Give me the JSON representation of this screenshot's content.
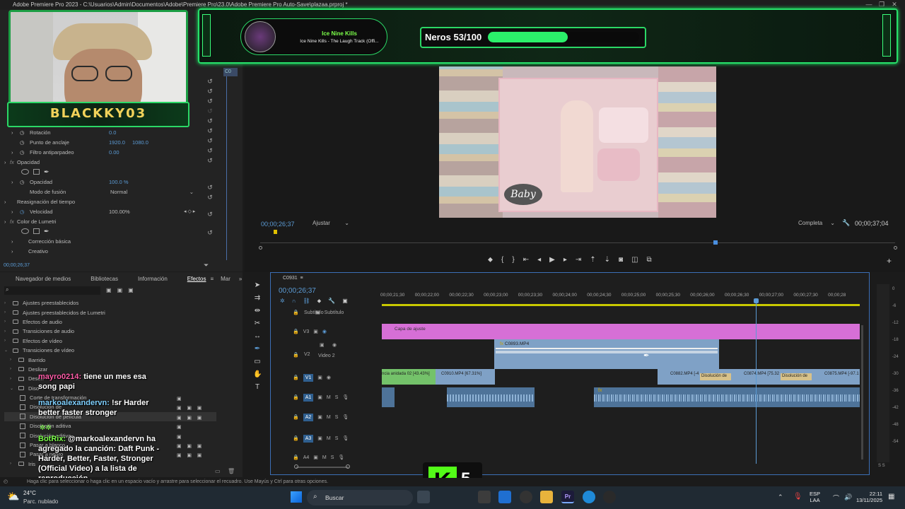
{
  "window": {
    "title": "Adobe Premiere Pro 2023 - C:\\Usuarios\\Admin\\Documentos\\Adobe\\Premiere Pro\\23.0\\Adobe Premiere Pro Auto-Save\\plazaa.prproj *",
    "controls": [
      "—",
      "❐",
      "✕"
    ]
  },
  "overlay": {
    "streamer_name": "BLACKKY03",
    "song_artist": "Ice Nine Kills",
    "song_title": "Ice Nine Kills - The Laugh Track (Offi...",
    "goal_label": "Neros 53/100",
    "goal_progress": 0.53,
    "kick_label": "5"
  },
  "effects_controls": {
    "tab_fragment": "C0",
    "rows": [
      {
        "label": "Rotación",
        "value": "0.0"
      },
      {
        "label": "Punto de anclaje",
        "value": "1920.0",
        "value2": "1080.0"
      },
      {
        "label": "Filtro antiparpadeo",
        "value": "0.00"
      },
      {
        "label": "Opacidad",
        "section": true
      },
      {
        "label": "Opacidad",
        "value": "100.0 %"
      },
      {
        "label": "Modo de fusión",
        "value": "Normal"
      },
      {
        "label": "Reasignación del tiempo",
        "section": true
      },
      {
        "label": "Velocidad",
        "value": "100.00%"
      },
      {
        "label": "Color de Lumetri",
        "section": true
      },
      {
        "label": "Corrección básica"
      },
      {
        "label": "Creativo"
      }
    ],
    "timecode": "00;00;26;37"
  },
  "program_monitor": {
    "timecode": "00;00;26;37",
    "fit": "Ajustar",
    "quality": "Completa",
    "duration": "00;00;37;04"
  },
  "effects_panel": {
    "tabs": [
      "Navegador de medios",
      "Bibliotecas",
      "Información",
      "Efectos",
      "Mar"
    ],
    "active_tab": "Efectos",
    "tree": [
      "Ajustes preestablecidos",
      "Ajustes preestablecidos de Lumetri",
      "Efectos de audio",
      "Transiciones de audio",
      "Efectos de vídeo",
      "Transiciones de vídeo",
      "Barrido",
      "Deslizar",
      "Desen",
      "Diso",
      "Corte de transformación",
      "Disolución de",
      "Disolución de película",
      "Disolución aditiva",
      "Disolución aditiva",
      "Pasar a blanco",
      "Pasar a negro",
      "Iris"
    ]
  },
  "chat": [
    {
      "user": "mayro0214:",
      "user_color": "#ff5ca8",
      "text": "tiene un mes esa song papi"
    },
    {
      "user": "markoalexandervn:",
      "user_color": "#7fd0ff",
      "text": "!sr Harder better faster stronger"
    },
    {
      "user": "BotRix:",
      "user_color": "#7cff4a",
      "text": "@markoalexandervn ha agregado la canción: Daft Punk - Harder, Better, Faster, Stronger (Official Video) a la lista de reproducción."
    }
  ],
  "timeline": {
    "sequence": "C0931",
    "timecode": "00;00;26;37",
    "ruler": [
      "00;00;21;30",
      "00;00;22;00",
      "00;00;22;30",
      "00;00;23;00",
      "00;00;23;30",
      "00;00;24;00",
      "00;00;24;30",
      "00;00;25;00",
      "00;00;25;30",
      "00;00;26;00",
      "00;00;26;30",
      "00;00;27;00",
      "00;00;27;30",
      "00;00;28"
    ],
    "tracks": {
      "c1": "Subtítulo",
      "v3": "V3",
      "v2": "V2",
      "v2_name": "Video 2",
      "v1": "V1",
      "a1": "A1",
      "a2": "A2",
      "a3": "A3",
      "a4": "A4"
    },
    "clips": {
      "adjustment": "Capa de ajuste",
      "c0893": "C0893.MP4",
      "nested": "ncia anidada 02 [43.43%]",
      "c0910": "C0910.MP4 [67.31%]",
      "c0882": "C0882.MP4 [-4",
      "c0874": "C0874.MP4 [75.32",
      "c0875": "C0875.MP4 [-97.1",
      "dissolve1": "Disolución de",
      "dissolve2": "Disolución de"
    },
    "meter_ticks": [
      "0",
      "-6",
      "-12",
      "-18",
      "-24",
      "-30",
      "-36",
      "-42",
      "-48",
      "-54"
    ],
    "meter_bottom": "S S"
  },
  "status_bar": {
    "text": "Haga clic para seleccionar o haga clic en un espacio vacío y arrastre para seleccionar el recuadro. Use Mayús y Ctrl para otras opciones."
  },
  "taskbar": {
    "weather_temp": "24°C",
    "weather_desc": "Parc. nublado",
    "search": "Buscar",
    "lang": "ESP",
    "lang2": "LAA",
    "time": "22:11",
    "date": "13/11/2025"
  }
}
